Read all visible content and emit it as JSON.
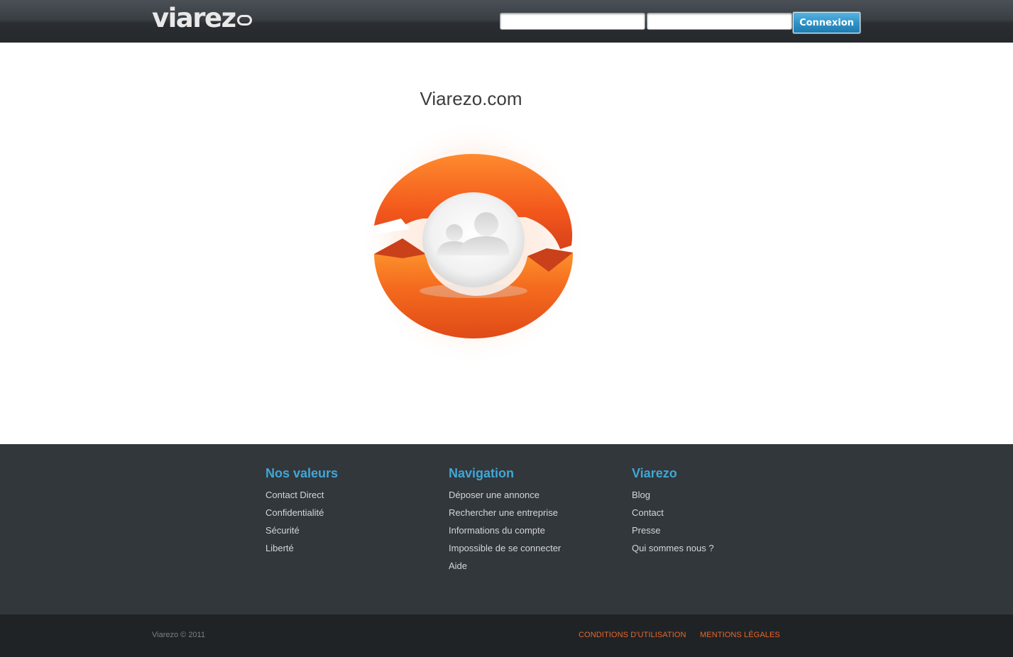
{
  "header": {
    "logo_text": "viarez",
    "username_placeholder": "",
    "password_placeholder": "",
    "login_label": "Connexion"
  },
  "main": {
    "title": "Viarezo.com",
    "hero_icon": "users-icon"
  },
  "footer": {
    "columns": [
      {
        "heading": "Nos valeurs",
        "links": [
          "Contact Direct",
          "Confidentialité",
          "Sécurité",
          "Liberté"
        ]
      },
      {
        "heading": "Navigation",
        "links": [
          "Déposer une annonce",
          "Rechercher une entreprise",
          "Informations du compte",
          "Impossible de se connecter",
          "Aide"
        ]
      },
      {
        "heading": "Viarezo",
        "links": [
          "Blog",
          "Contact",
          "Presse",
          "Qui sommes nous ?"
        ]
      }
    ],
    "copyright": "Viarezo © 2011",
    "legal": {
      "terms": "CONDITIONS D'UTILISATION",
      "notice": "MENTIONS LÉGALES"
    }
  },
  "colors": {
    "accent_blue": "#3fa7d8",
    "brand_orange": "#f26a1f",
    "legal_orange": "#e8662c",
    "footer_bg": "#32373b",
    "bottom_bg": "#1f2326"
  }
}
